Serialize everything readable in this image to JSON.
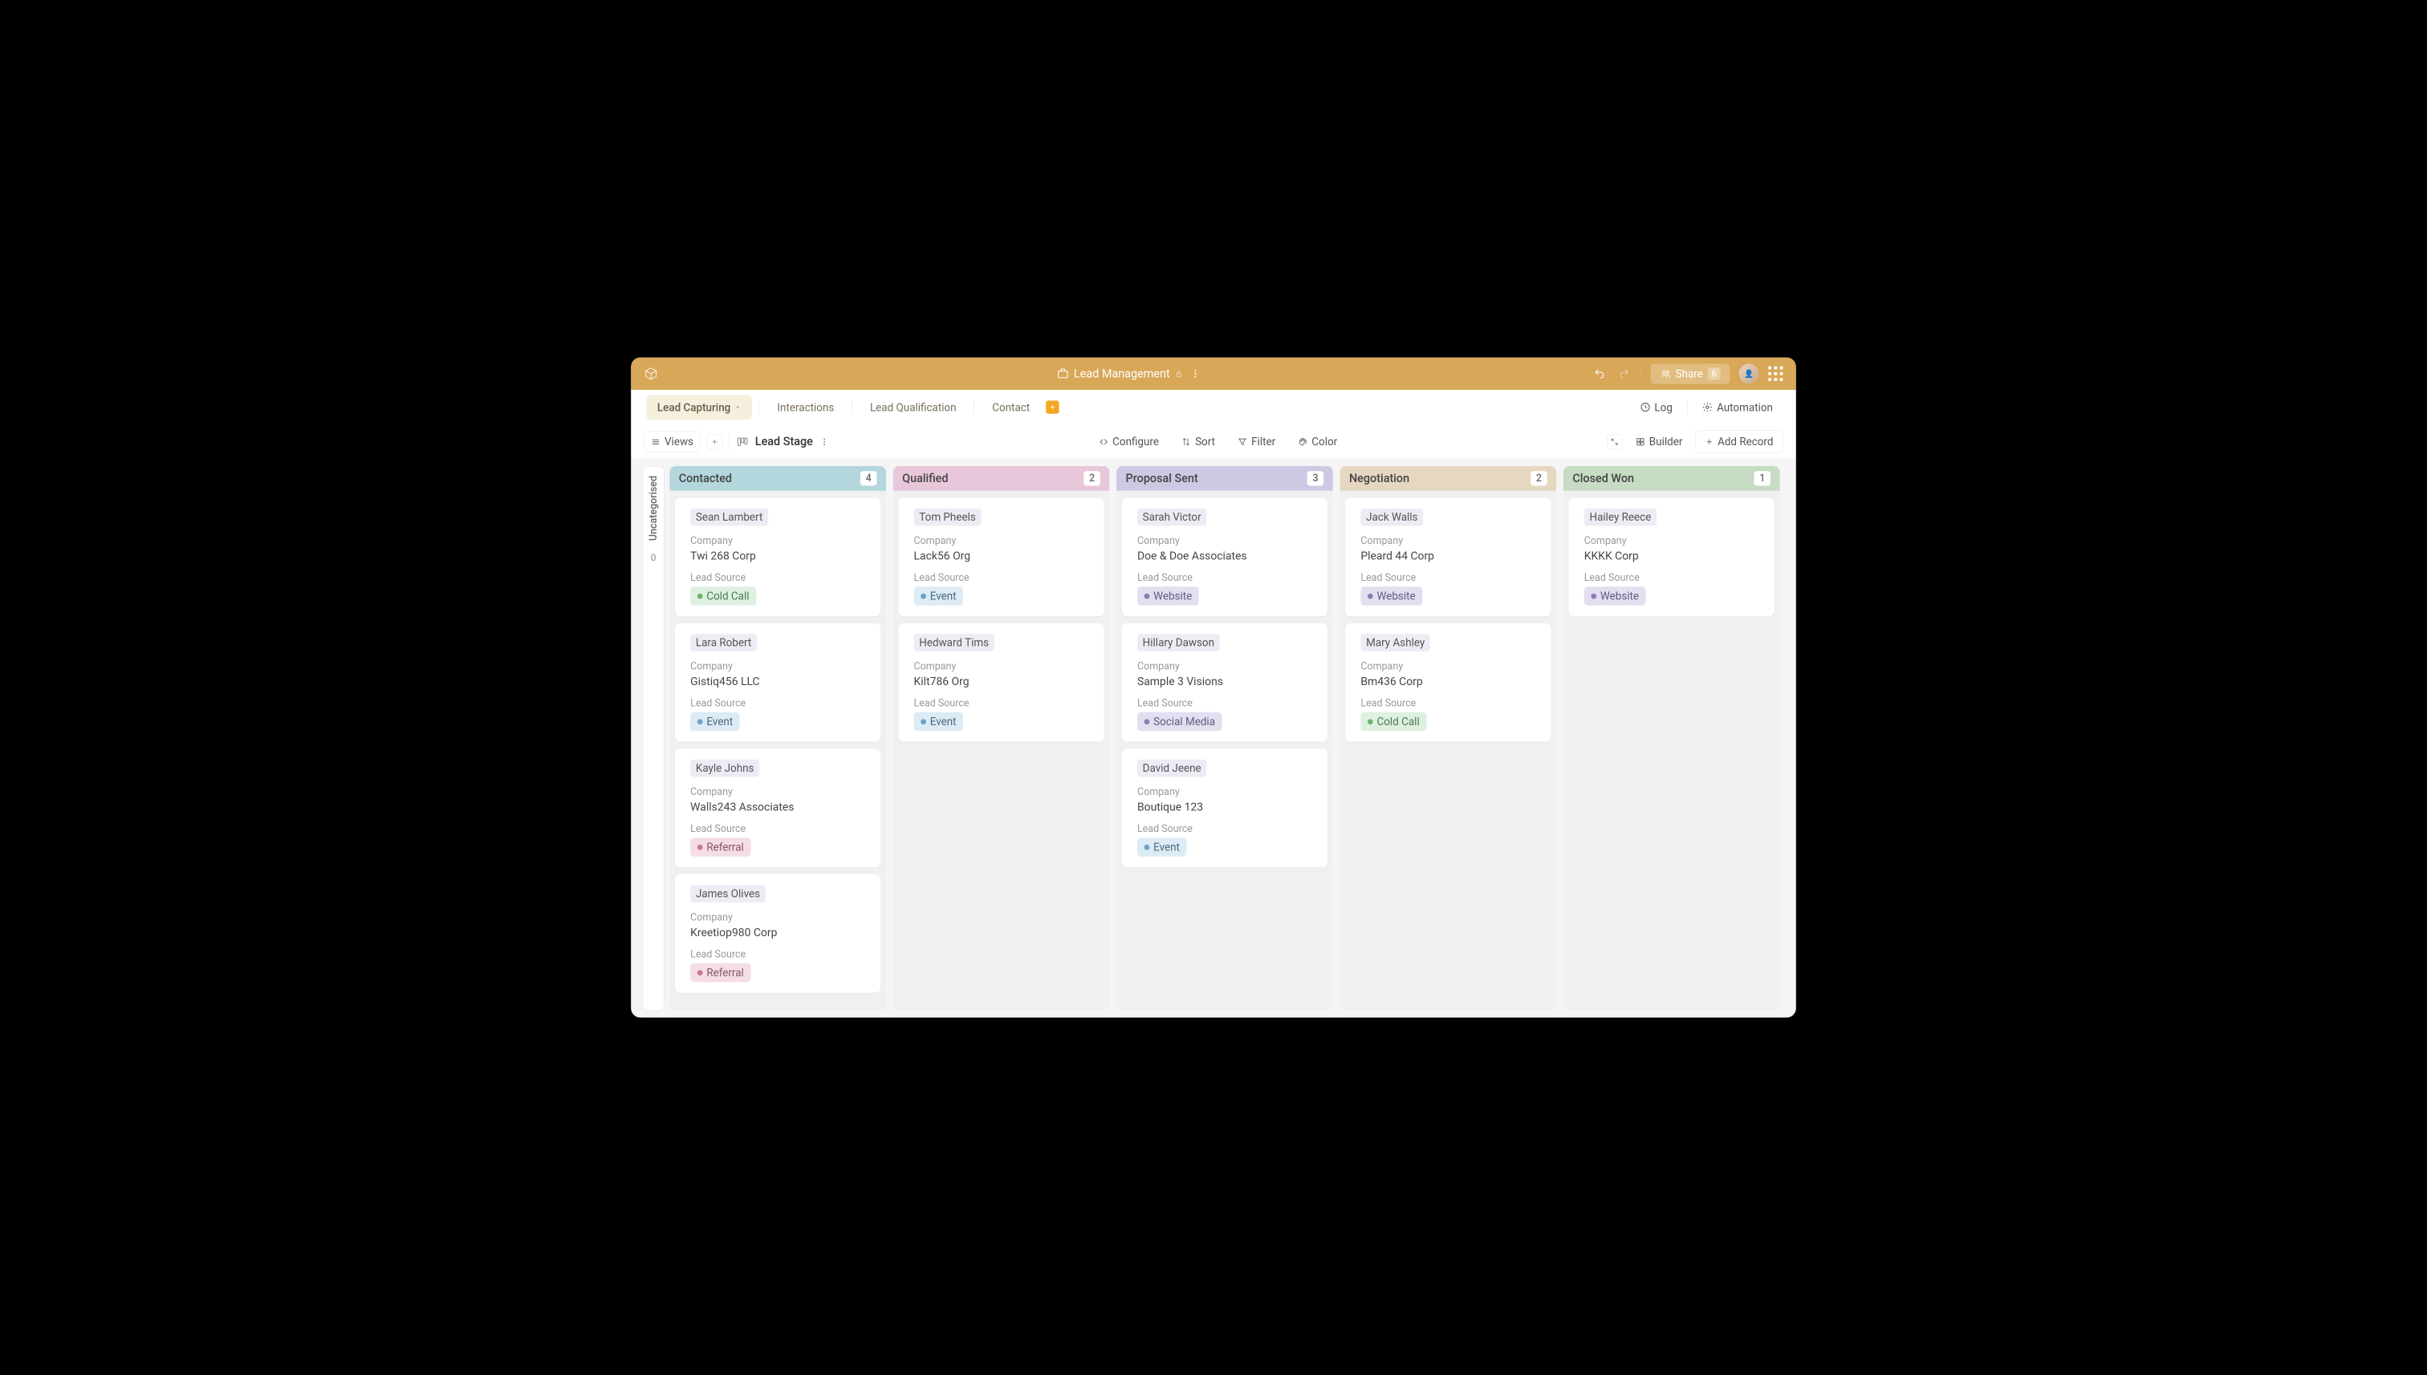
{
  "header": {
    "title": "Lead Management",
    "share": "Share",
    "shareCount": "6"
  },
  "toolbar": {
    "tabs": [
      "Lead Capturing",
      "Interactions",
      "Lead Qualification",
      "Contact"
    ],
    "log": "Log",
    "automation": "Automation"
  },
  "viewsbar": {
    "views": "Views",
    "current": "Lead Stage",
    "configure": "Configure",
    "sort": "Sort",
    "filter": "Filter",
    "color": "Color",
    "builder": "Builder",
    "addRecord": "Add Record"
  },
  "uncat": {
    "label": "Uncategorised",
    "count": "0"
  },
  "labels": {
    "company": "Company",
    "leadSource": "Lead Source"
  },
  "columns": [
    {
      "name": "Contacted",
      "count": "4",
      "headClass": "h-contacted",
      "cards": [
        {
          "name": "Sean Lambert",
          "company": "Twi 268 Corp",
          "source": "Cold Call",
          "tagClass": "t-coldcall"
        },
        {
          "name": "Lara Robert",
          "company": "Gistiq456 LLC",
          "source": "Event",
          "tagClass": "t-event"
        },
        {
          "name": "Kayle Johns",
          "company": "Walls243 Associates",
          "source": "Referral",
          "tagClass": "t-referral"
        },
        {
          "name": "James Olives",
          "company": "Kreetiop980 Corp",
          "source": "Referral",
          "tagClass": "t-referral"
        }
      ]
    },
    {
      "name": "Qualified",
      "count": "2",
      "headClass": "h-qualified",
      "cards": [
        {
          "name": "Tom Pheels",
          "company": "Lack56 Org",
          "source": "Event",
          "tagClass": "t-event"
        },
        {
          "name": "Hedward Tims",
          "company": "Kilt786 Org",
          "source": "Event",
          "tagClass": "t-event"
        }
      ]
    },
    {
      "name": "Proposal Sent",
      "count": "3",
      "headClass": "h-proposal",
      "cards": [
        {
          "name": "Sarah Victor",
          "company": "Doe & Doe Associates",
          "source": "Website",
          "tagClass": "t-website"
        },
        {
          "name": "Hillary Dawson",
          "company": "Sample 3 Visions",
          "source": "Social Media",
          "tagClass": "t-social"
        },
        {
          "name": "David Jeene",
          "company": "Boutique 123",
          "source": "Event",
          "tagClass": "t-event"
        }
      ]
    },
    {
      "name": "Negotiation",
      "count": "2",
      "headClass": "h-negotiation",
      "cards": [
        {
          "name": "Jack Walls",
          "company": "Pleard 44 Corp",
          "source": "Website",
          "tagClass": "t-website"
        },
        {
          "name": "Mary Ashley",
          "company": "Bm436 Corp",
          "source": "Cold Call",
          "tagClass": "t-coldcall"
        }
      ]
    },
    {
      "name": "Closed Won",
      "count": "1",
      "headClass": "h-closed",
      "cards": [
        {
          "name": "Hailey Reece",
          "company": "KKKK Corp",
          "source": "Website",
          "tagClass": "t-website"
        }
      ]
    }
  ]
}
